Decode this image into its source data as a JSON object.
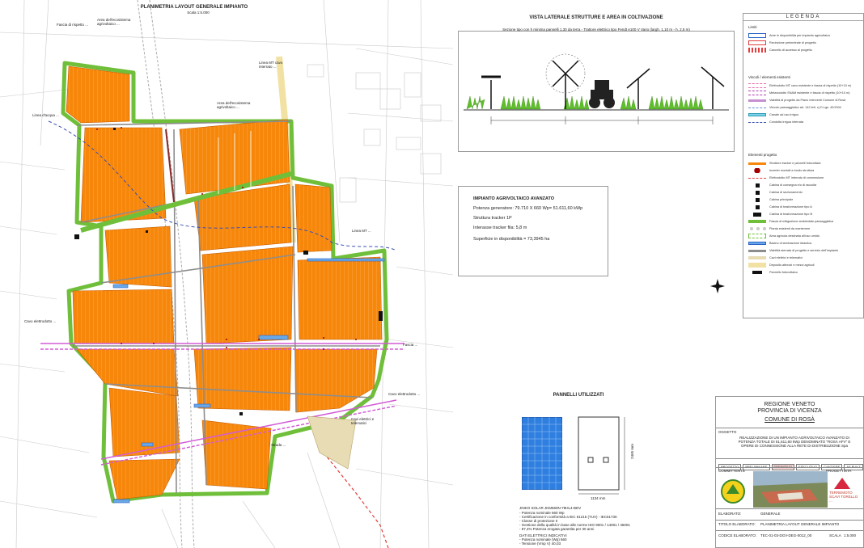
{
  "map": {
    "title": "PLANIMETRIA LAYOUT GENERALE IMPIANTO",
    "scale": "Scala 1:5.000",
    "annotations": [
      "Fascia di rispetto ...",
      "Area dell'ecosistema agrivoltaico ...",
      "Linea d'acqua ...",
      "Area dell'ecosistema agrivoltaico ...",
      "Linea MT cavo interrato ...",
      "Linea MT ...",
      "Cavo elettrodotto ...",
      "Cavo elettrodotto ...",
      "Cavi elettrici e telematici",
      "Fascia ...",
      "Strada ..."
    ]
  },
  "side_view": {
    "title": "VISTA LATERALE STRUTTURE E AREA IN COLTIVAZIONE",
    "subtitle": "Sezione tipo con h minima pannelli 1,30 da terra - Trattore elettrico tipo Fendt e100 V Vario (largh. 1,10 m - h. 2,5 m)"
  },
  "impianto": {
    "title": "IMPIANTO AGRIVOLTAICO AVANZATO",
    "lines": [
      "Potenza generatore: 79.710 X 660 Wp= 51.611,60 kWp",
      "Struttura tracker 1P",
      "Interasse tracker fila: 5,8 m",
      "Superficie in disponibilità = 73,3945 ha"
    ]
  },
  "pannelli": {
    "title": "PANNELLI UTILIZZATI",
    "specs": [
      "JINKO SOLAR JKM660N-78HL4-BDV",
      "- Potenza nominale 660 Wp",
      "- Certificazione in conformità a IEC 61215 (TUV) - IEC61730",
      "- Classe di protezione II",
      "- Gestione della qualità in base alle norme ISO 9001 / 14001 / 45001",
      "- 87,4% Potenza erogata garantita per 30 anni",
      "DATI ELETTRICI INDICATIVI",
      "- Potenza nominale (Wp) 660",
      "- Tensione (Vmp V) 40,03"
    ],
    "dim_h": "2465 mm",
    "dim_w": "1134 mm"
  },
  "legend": {
    "title": "LEGENDA",
    "sections": [
      "Limiti",
      "Vincoli / elementi esistenti",
      "Elementi progetto"
    ],
    "items": [
      {
        "label": "Aree in disponibilità per impianto agrivoltaico",
        "style": "blue-box"
      },
      {
        "label": "Recinzione perimetrale di progetto",
        "style": "red-box"
      },
      {
        "label": "Cancello di accesso al progetto",
        "style": "red-gate"
      },
      {
        "label": "Elettrodotto MT cavo esistente e fascia di rispetto (10+10 m)",
        "style": "pink-dash"
      },
      {
        "label": "Metanodotto SNAM esistente e fascia di rispetto (10+10 m)",
        "style": "magenta-dash"
      },
      {
        "label": "Viabilità di progetto da Piano Interventi Comune di Rosà",
        "style": "purple-line"
      },
      {
        "label": "Vincolo paesaggistico art. 142 lett. c) D.Lgs. 42/2004",
        "style": "blue-dash"
      },
      {
        "label": "Canale ad uso irriguo",
        "style": "cyan-line"
      },
      {
        "label": "Condotta irrigua interrata",
        "style": "blue-dash2"
      },
      {
        "label": "Strutture tracker e pannelli fotovoltaici",
        "style": "orange-line"
      },
      {
        "label": "Inverter montati a bordo struttura",
        "style": "red-dot"
      },
      {
        "label": "Elettrodotto MT interrato di connessione",
        "style": "red-dash"
      },
      {
        "label": "Cabina di consegna e/o di raccolta",
        "style": "black-sq"
      },
      {
        "label": "Cabina di sezionamento",
        "style": "black-sq"
      },
      {
        "label": "Cabina principale",
        "style": "black-sq"
      },
      {
        "label": "Cabina di trasformazione tipo A",
        "style": "black-sq"
      },
      {
        "label": "Cabina di trasformazione tipo B",
        "style": "black-rect"
      },
      {
        "label": "Fascia di mitigazione ambientale paesaggistica",
        "style": "green-line"
      },
      {
        "label": "Pianta esistenti da mantenere",
        "style": "grey-dots"
      },
      {
        "label": "Area agricola destinata all'uso umido",
        "style": "green-dash"
      },
      {
        "label": "Bacino di laminazione idraulica",
        "style": "blue-fill"
      },
      {
        "label": "Viabilità sterrata di progetto e servizio dell'impianto",
        "style": "grey-line"
      },
      {
        "label": "Cavi elettrici e telematici",
        "style": "beige-line"
      },
      {
        "label": "Deposito attrezzi e mezzi agricoli",
        "style": "beige-box"
      },
      {
        "label": "Pannello fotovoltaico",
        "style": "black-pill"
      }
    ]
  },
  "title_block": {
    "region": "REGIONE VENETO",
    "province": "PROVINCIA DI VICENZA",
    "comune": "COMUNE DI ROSÀ",
    "oggetto_label": "OGGETTO",
    "oggetto_text": "REALIZZAZIONE DI UN IMPIANTO AGRIVOLTAICO AVANZATO DI POTENZA TOTALE DI 51,611,60 kWp DENOMINATO \"ROSÀ AFV\" E OPERE DI CONNESSIONE ALLA RETE DI DISTRIBUZIONE Spa",
    "phases": [
      "PROGETTO",
      "PRELIMINARE",
      "DEFINITIVO",
      "ESECUTIVO",
      "CANTIERE",
      "AS BUILT"
    ],
    "elaborato_label": "ELABORATO:",
    "elaborato_value": "GENERALE",
    "titolo_label": "TITOLO ELABORATO:",
    "titolo_value": "PLANIMETRIA LAYOUT GENERALE IMPIANTO",
    "codice_label": "CODICE ELABORATO:",
    "codice_value": "TEC-01-03-DGV-DEG-0012_00",
    "scala_label": "SCALA",
    "scala_value": "1:5.000",
    "committente": "COMMITTENTE",
    "progettista": "PROGETTISTA",
    "firm_right": "TERREMOTO SCAVI TORELLO ..."
  },
  "colors": {
    "orange": "#f7870b",
    "green": "#6fbf3a",
    "magenta": "#d25bd6",
    "blue": "#2b63c9",
    "red": "#e33c3c"
  }
}
